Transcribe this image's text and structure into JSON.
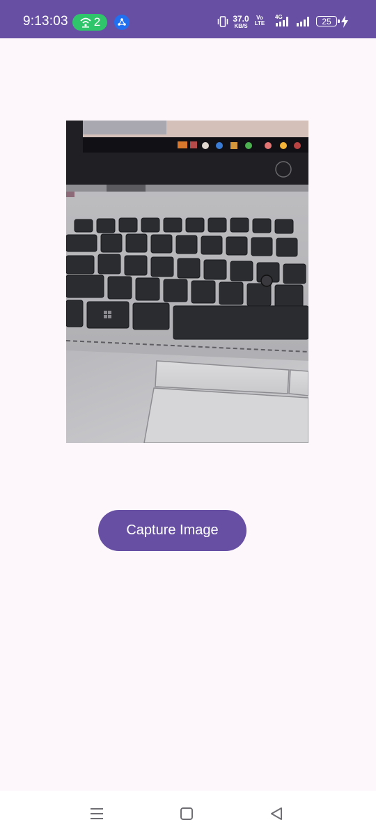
{
  "status_bar": {
    "time": "9:13:03",
    "hotspot_count": "2",
    "net_speed_value": "37.0",
    "net_speed_unit": "KB/S",
    "volte_top": "Vo",
    "volte_bottom": "LTE",
    "sim1_slot": "1",
    "sim2_slot": "2",
    "network_type": "4G",
    "battery_level": "25",
    "icons": [
      "hotspot-icon",
      "share-icon",
      "vibrate-icon",
      "signal-icon",
      "signal-icon",
      "battery-icon",
      "charging-icon"
    ]
  },
  "main": {
    "photo_description_icon": "camera-preview",
    "capture_button_label": "Capture Image"
  },
  "nav_bar": {
    "icons": [
      "recents-icon",
      "home-icon",
      "back-icon"
    ]
  },
  "colors": {
    "accent": "#6750a4",
    "background": "#fdf7fc",
    "hotspot_green": "#2fc66b",
    "share_blue": "#1f6ff0"
  }
}
